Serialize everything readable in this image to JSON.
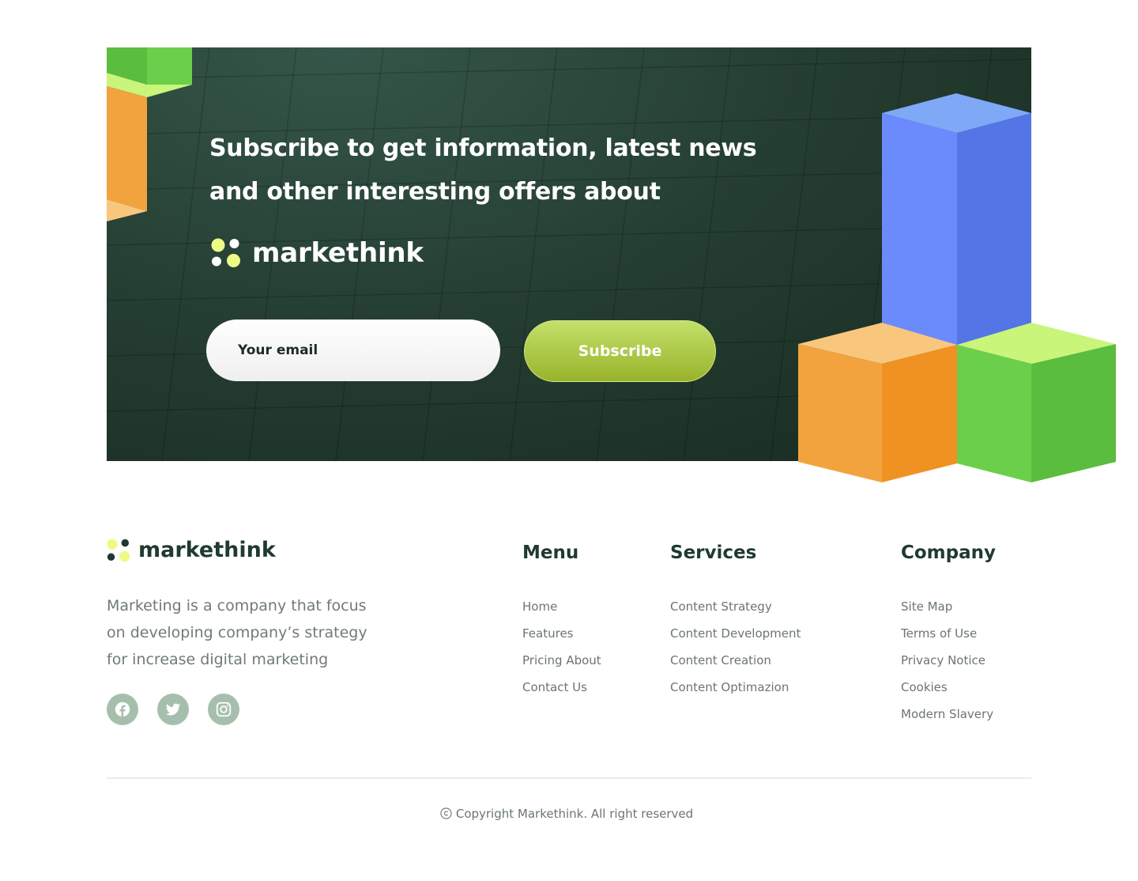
{
  "banner": {
    "title": "Subscribe to get information, latest news and other interesting offers about",
    "brand_name": "markethink",
    "email_placeholder": "Your email",
    "subscribe_label": "Subscribe"
  },
  "footer": {
    "brand_name": "markethink",
    "description": "Marketing is a company that focus on developing company’s strategy for increase digital marketing",
    "socials": [
      {
        "icon": "facebook-icon"
      },
      {
        "icon": "twitter-icon"
      },
      {
        "icon": "instagram-icon"
      }
    ],
    "columns": {
      "menu": {
        "title": "Menu",
        "items": [
          "Home",
          "Features",
          "Pricing About",
          "Contact Us"
        ]
      },
      "services": {
        "title": "Services",
        "items": [
          "Content Strategy",
          "Content Development",
          "Content Creation",
          "Content Optimazion"
        ]
      },
      "company": {
        "title": "Company",
        "items": [
          "Site Map",
          "Terms of Use",
          "Privacy Notice",
          "Cookies",
          "Modern Slavery"
        ]
      }
    },
    "copyright": "Copyright Markethink. All right reserved"
  },
  "colors": {
    "banner_dark": "#263f33",
    "accent_lime": "#c3e06a",
    "brand_dark": "#1f3a2e",
    "social_bg": "#a6bfad",
    "cube_blue": "#6b8afc",
    "cube_orange": "#f3a33e",
    "cube_green": "#6cce4a"
  }
}
